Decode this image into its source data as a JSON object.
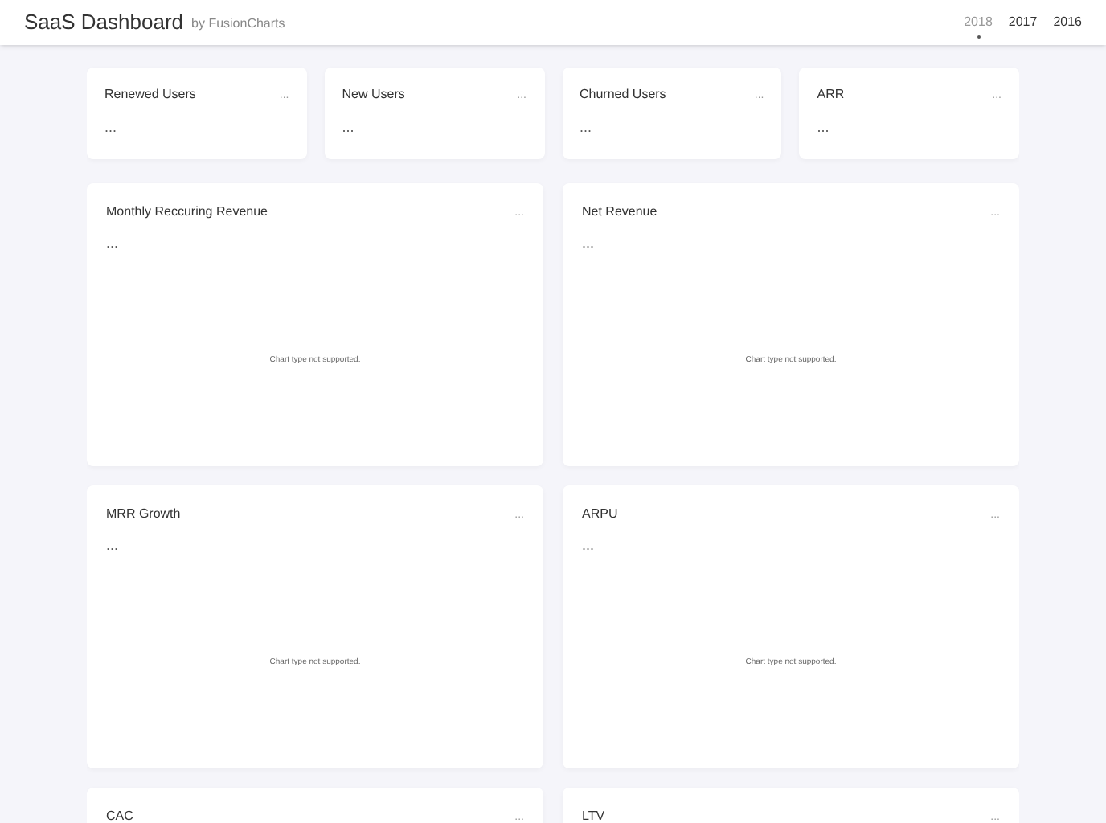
{
  "header": {
    "title": "SaaS Dashboard",
    "subtitle": "by FusionCharts",
    "years": [
      {
        "label": "2018",
        "selected": true
      },
      {
        "label": "2017",
        "selected": false
      },
      {
        "label": "2016",
        "selected": false
      }
    ]
  },
  "kpis": [
    {
      "title": "Renewed Users",
      "menu": "...",
      "value": "..."
    },
    {
      "title": "New Users",
      "menu": "...",
      "value": "..."
    },
    {
      "title": "Churned Users",
      "menu": "...",
      "value": "..."
    },
    {
      "title": "ARR",
      "menu": "...",
      "value": "..."
    }
  ],
  "charts": [
    {
      "title": "Monthly Reccuring Revenue",
      "menu": "...",
      "value": "...",
      "message": "Chart type not supported."
    },
    {
      "title": "Net Revenue",
      "menu": "...",
      "value": "...",
      "message": "Chart type not supported."
    },
    {
      "title": "MRR Growth",
      "menu": "...",
      "value": "...",
      "message": "Chart type not supported."
    },
    {
      "title": "ARPU",
      "menu": "...",
      "value": "...",
      "message": "Chart type not supported."
    },
    {
      "title": "CAC",
      "menu": "..."
    },
    {
      "title": "LTV",
      "menu": "..."
    }
  ]
}
